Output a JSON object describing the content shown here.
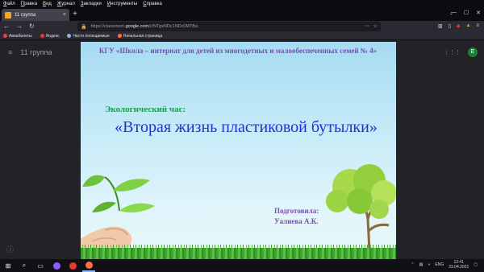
{
  "menubar": {
    "items": [
      "Файл",
      "Правка",
      "Вид",
      "Журнал",
      "Закладки",
      "Инструменты",
      "Справка"
    ]
  },
  "tabs": [
    {
      "title": "11 группа",
      "close": "×"
    }
  ],
  "tabbar": {
    "new_tab": "+",
    "list_tabs": "⌄"
  },
  "window": {
    "minimize": "—",
    "maximize": "☐",
    "close": "✕"
  },
  "nav": {
    "back": "←",
    "forward": "→",
    "reload": "↻",
    "url_prefix": "https://classroom.",
    "url_domain": "google.com",
    "url_path": "/c/NTgxNDc1NDc0MTBa"
  },
  "bookmarks": [
    {
      "label": "Авиабилеты",
      "color": "#e04848"
    },
    {
      "label": "Яндекс",
      "color": "#e53935"
    },
    {
      "label": "Часто посещаемые",
      "color": "#8fb1e8"
    },
    {
      "label": "Начальная страница",
      "color": "#ff7139"
    }
  ],
  "classroom": {
    "class_name": "11 группа",
    "avatar_letter": "Е"
  },
  "slide": {
    "org": "КГУ «Школа – интернат для детей из многодетных и малообеспеченных семей № 4»",
    "subtitle": "Экологический час:",
    "title": "«Вторая жизнь пластиковой бутылки»",
    "author_label": "Подготовила:",
    "author_name": "Уалиева А.К."
  },
  "taskbar": {
    "lang": "ENG",
    "time": "12:41",
    "date": "23.04.2021"
  },
  "colors": {
    "slide_purple": "#7e4db0",
    "slide_green": "#19a04a",
    "slide_blue": "#2330d8",
    "avatar_green": "#1a7f37"
  }
}
